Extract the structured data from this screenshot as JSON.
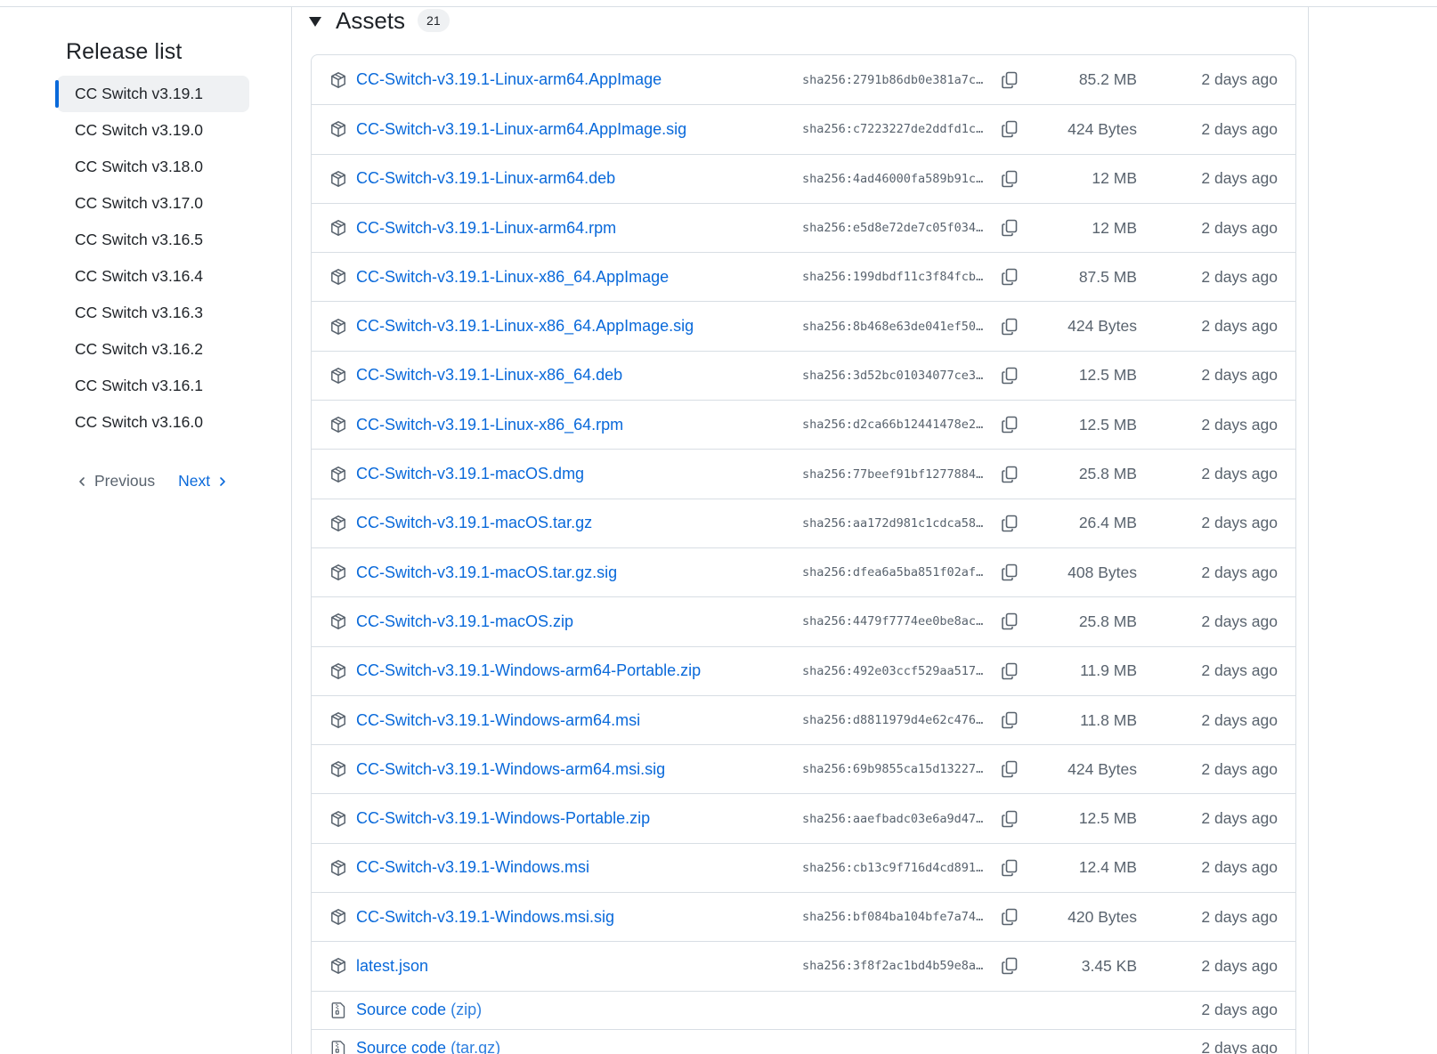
{
  "sidebar": {
    "title": "Release list",
    "releases": [
      {
        "label": "CC Switch v3.19.1",
        "active": true
      },
      {
        "label": "CC Switch v3.19.0",
        "active": false
      },
      {
        "label": "CC Switch v3.18.0",
        "active": false
      },
      {
        "label": "CC Switch v3.17.0",
        "active": false
      },
      {
        "label": "CC Switch v3.16.5",
        "active": false
      },
      {
        "label": "CC Switch v3.16.4",
        "active": false
      },
      {
        "label": "CC Switch v3.16.3",
        "active": false
      },
      {
        "label": "CC Switch v3.16.2",
        "active": false
      },
      {
        "label": "CC Switch v3.16.1",
        "active": false
      },
      {
        "label": "CC Switch v3.16.0",
        "active": false
      }
    ],
    "pager": {
      "previous": "Previous",
      "next": "Next"
    }
  },
  "assets": {
    "title": "Assets",
    "count": "21",
    "files": [
      {
        "name": "CC-Switch-v3.19.1-Linux-arm64.AppImage",
        "sha": "sha256:2791b86db0e381a7c…",
        "size": "85.2 MB",
        "date": "2 days ago"
      },
      {
        "name": "CC-Switch-v3.19.1-Linux-arm64.AppImage.sig",
        "sha": "sha256:c7223227de2ddfd1c…",
        "size": "424 Bytes",
        "date": "2 days ago"
      },
      {
        "name": "CC-Switch-v3.19.1-Linux-arm64.deb",
        "sha": "sha256:4ad46000fa589b91c…",
        "size": "12 MB",
        "date": "2 days ago"
      },
      {
        "name": "CC-Switch-v3.19.1-Linux-arm64.rpm",
        "sha": "sha256:e5d8e72de7c05f034…",
        "size": "12 MB",
        "date": "2 days ago"
      },
      {
        "name": "CC-Switch-v3.19.1-Linux-x86_64.AppImage",
        "sha": "sha256:199dbdf11c3f84fcb…",
        "size": "87.5 MB",
        "date": "2 days ago"
      },
      {
        "name": "CC-Switch-v3.19.1-Linux-x86_64.AppImage.sig",
        "sha": "sha256:8b468e63de041ef50…",
        "size": "424 Bytes",
        "date": "2 days ago"
      },
      {
        "name": "CC-Switch-v3.19.1-Linux-x86_64.deb",
        "sha": "sha256:3d52bc01034077ce3…",
        "size": "12.5 MB",
        "date": "2 days ago"
      },
      {
        "name": "CC-Switch-v3.19.1-Linux-x86_64.rpm",
        "sha": "sha256:d2ca66b12441478e2…",
        "size": "12.5 MB",
        "date": "2 days ago"
      },
      {
        "name": "CC-Switch-v3.19.1-macOS.dmg",
        "sha": "sha256:77beef91bf1277884…",
        "size": "25.8 MB",
        "date": "2 days ago"
      },
      {
        "name": "CC-Switch-v3.19.1-macOS.tar.gz",
        "sha": "sha256:aa172d981c1cdca58…",
        "size": "26.4 MB",
        "date": "2 days ago"
      },
      {
        "name": "CC-Switch-v3.19.1-macOS.tar.gz.sig",
        "sha": "sha256:dfea6a5ba851f02af…",
        "size": "408 Bytes",
        "date": "2 days ago"
      },
      {
        "name": "CC-Switch-v3.19.1-macOS.zip",
        "sha": "sha256:4479f7774ee0be8ac…",
        "size": "25.8 MB",
        "date": "2 days ago"
      },
      {
        "name": "CC-Switch-v3.19.1-Windows-arm64-Portable.zip",
        "sha": "sha256:492e03ccf529aa517…",
        "size": "11.9 MB",
        "date": "2 days ago"
      },
      {
        "name": "CC-Switch-v3.19.1-Windows-arm64.msi",
        "sha": "sha256:d8811979d4e62c476…",
        "size": "11.8 MB",
        "date": "2 days ago"
      },
      {
        "name": "CC-Switch-v3.19.1-Windows-arm64.msi.sig",
        "sha": "sha256:69b9855ca15d13227…",
        "size": "424 Bytes",
        "date": "2 days ago"
      },
      {
        "name": "CC-Switch-v3.19.1-Windows-Portable.zip",
        "sha": "sha256:aaefbadc03e6a9d47…",
        "size": "12.5 MB",
        "date": "2 days ago"
      },
      {
        "name": "CC-Switch-v3.19.1-Windows.msi",
        "sha": "sha256:cb13c9f716d4cd891…",
        "size": "12.4 MB",
        "date": "2 days ago"
      },
      {
        "name": "CC-Switch-v3.19.1-Windows.msi.sig",
        "sha": "sha256:bf084ba104bfe7a74…",
        "size": "420 Bytes",
        "date": "2 days ago"
      },
      {
        "name": "latest.json",
        "sha": "sha256:3f8f2ac1bd4b59e8a…",
        "size": "3.45 KB",
        "date": "2 days ago"
      }
    ],
    "source": [
      {
        "label": "Source code",
        "format": "(zip)",
        "date": "2 days ago"
      },
      {
        "label": "Source code",
        "format": "(tar.gz)",
        "date": "2 days ago"
      }
    ]
  },
  "icons": {
    "package": "package-icon",
    "copy": "copy-icon",
    "zip": "file-zip-icon",
    "chevron_left": "chevron-left-icon",
    "chevron_right": "chevron-right-icon",
    "caret": "triangle-down-icon"
  },
  "colors": {
    "link": "#0969da",
    "muted": "#59636e",
    "border": "#d8dee4",
    "active_marker": "#0969da",
    "active_bg": "#eff1f3"
  }
}
